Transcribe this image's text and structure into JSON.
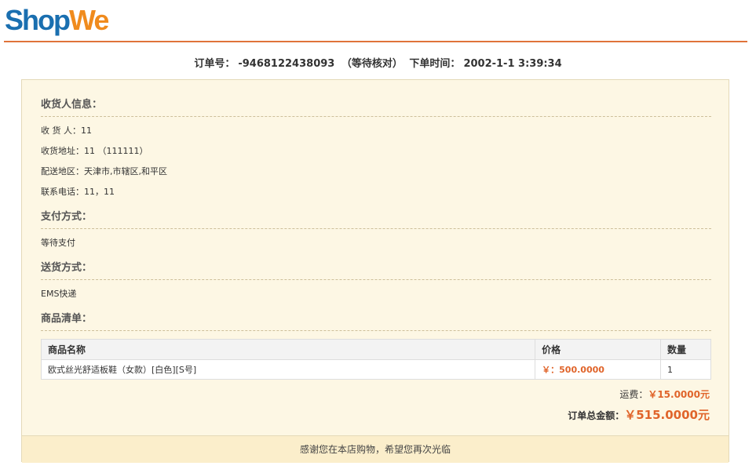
{
  "logo": {
    "part1": "Shop",
    "part2": "We"
  },
  "order": {
    "label": "订单号：",
    "number": "-9468122438093",
    "status": "（等待核对）",
    "time_label": "下单时间：",
    "time": "2002-1-1 3:39:34"
  },
  "receiver": {
    "title": "收货人信息：",
    "name": "收 货 人：11",
    "address": "收货地址：11 （111111）",
    "region": "配送地区：天津市,市辖区,和平区",
    "phone": "联系电话：11，11"
  },
  "payment": {
    "title": "支付方式：",
    "value": "等待支付"
  },
  "delivery": {
    "title": "送货方式：",
    "value": "EMS快递"
  },
  "goods": {
    "title": "商品清单：",
    "headers": [
      "商品名称",
      "价格",
      "数量"
    ],
    "rows": [
      {
        "name": "欧式丝光舒适板鞋（女款）[白色][S号]",
        "price": "￥：500.0000",
        "qty": "1"
      }
    ]
  },
  "shipping": {
    "label": "运费：",
    "amount": "￥15.0000元"
  },
  "total": {
    "label": "订单总金额：",
    "amount": "￥515.0000元"
  },
  "footer": {
    "text": "感谢您在本店购物，希望您再次光临"
  },
  "colors": {
    "accent": "#e0642a",
    "panel_bg": "#fdf7e4",
    "header_line": "#e0733a"
  }
}
